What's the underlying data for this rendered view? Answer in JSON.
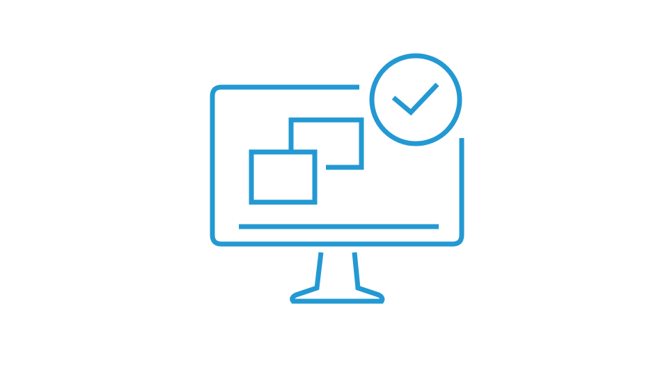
{
  "illustration": {
    "icon_name": "monitor-windows-checkmark-icon",
    "stroke_color": "#2399d3",
    "background_color": "#ffffff",
    "parts": {
      "monitor": "monitor-screen-icon",
      "stand": "monitor-stand-icon",
      "back_window": "back-window-icon",
      "front_window": "front-window-icon",
      "taskbar": "taskbar-line-icon",
      "badge": "check-circle-icon",
      "checkmark": "checkmark-icon"
    }
  }
}
